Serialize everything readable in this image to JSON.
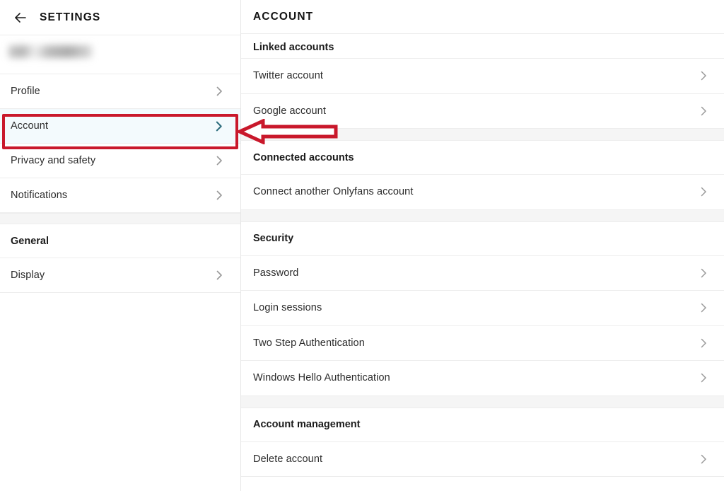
{
  "sidebar": {
    "back_icon": "arrow-left-icon",
    "title": "SETTINGS",
    "account_name_redacted": "",
    "items": [
      {
        "label": "Profile",
        "icon": "chevron-right-icon",
        "active": false
      },
      {
        "label": "Account",
        "icon": "chevron-right-icon",
        "active": true
      },
      {
        "label": "Privacy and safety",
        "icon": "chevron-right-icon",
        "active": false
      },
      {
        "label": "Notifications",
        "icon": "chevron-right-icon",
        "active": false
      }
    ],
    "general_section_title": "General",
    "general_items": [
      {
        "label": "Display",
        "icon": "chevron-right-icon",
        "active": false
      }
    ]
  },
  "content": {
    "title": "ACCOUNT",
    "groups": [
      {
        "title": "Linked accounts",
        "clipped": true,
        "items": [
          {
            "label": "Twitter account",
            "icon": "chevron-right-icon"
          },
          {
            "label": "Google account",
            "icon": "chevron-right-icon"
          }
        ]
      },
      {
        "title": "Connected accounts",
        "clipped": false,
        "items": [
          {
            "label": "Connect another Onlyfans account",
            "icon": "chevron-right-icon"
          }
        ]
      },
      {
        "title": "Security",
        "clipped": false,
        "items": [
          {
            "label": "Password",
            "icon": "chevron-right-icon"
          },
          {
            "label": "Login sessions",
            "icon": "chevron-right-icon"
          },
          {
            "label": "Two Step Authentication",
            "icon": "chevron-right-icon"
          },
          {
            "label": "Windows Hello Authentication",
            "icon": "chevron-right-icon"
          }
        ]
      },
      {
        "title": "Account management",
        "clipped": false,
        "items": [
          {
            "label": "Delete account",
            "icon": "chevron-right-icon"
          }
        ]
      }
    ]
  },
  "annotations": {
    "highlight_color": "#c9182b",
    "arrow_icon": "arrow-left-annotation-icon",
    "arrow_fill": "#ffffff",
    "arrow_stroke": "#c9182b",
    "highlight_target": "Account"
  },
  "colors": {
    "active_row_background": "#f3fafd",
    "active_chevron": "#2f6e7e",
    "chevron": "#9a9a9a",
    "divider": "#ededed",
    "section_gap": "#f5f5f5",
    "text_primary": "#2b2b2b",
    "text_heading": "#141414"
  }
}
